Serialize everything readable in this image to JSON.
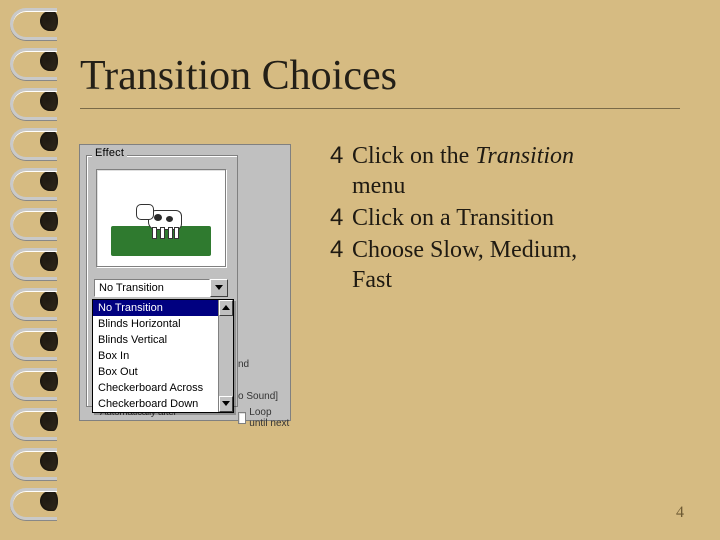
{
  "title": "Transition Choices",
  "page_number": "4",
  "bullet_marker": "4",
  "bullets": [
    {
      "pre": "Click on the",
      "em": "Transition",
      "post": "menu"
    },
    {
      "pre": "Click on a",
      "em": "",
      "post": "Transition"
    },
    {
      "pre": "Choose Slow,",
      "em": "",
      "post": "Medium, Fast"
    }
  ],
  "dialog": {
    "group_label": "Effect",
    "combo_selected": "No Transition",
    "dropdown_options": [
      "No Transition",
      "Blinds Horizontal",
      "Blinds Vertical",
      "Box In",
      "Box Out",
      "Checkerboard Across",
      "Checkerboard Down"
    ],
    "selected_index": 0,
    "truncated_bottom_label": "Automatically after",
    "truncated_right_label_1": "nd",
    "truncated_right_label_2": "o Sound]",
    "truncated_right_label_3": "Loop until next"
  }
}
